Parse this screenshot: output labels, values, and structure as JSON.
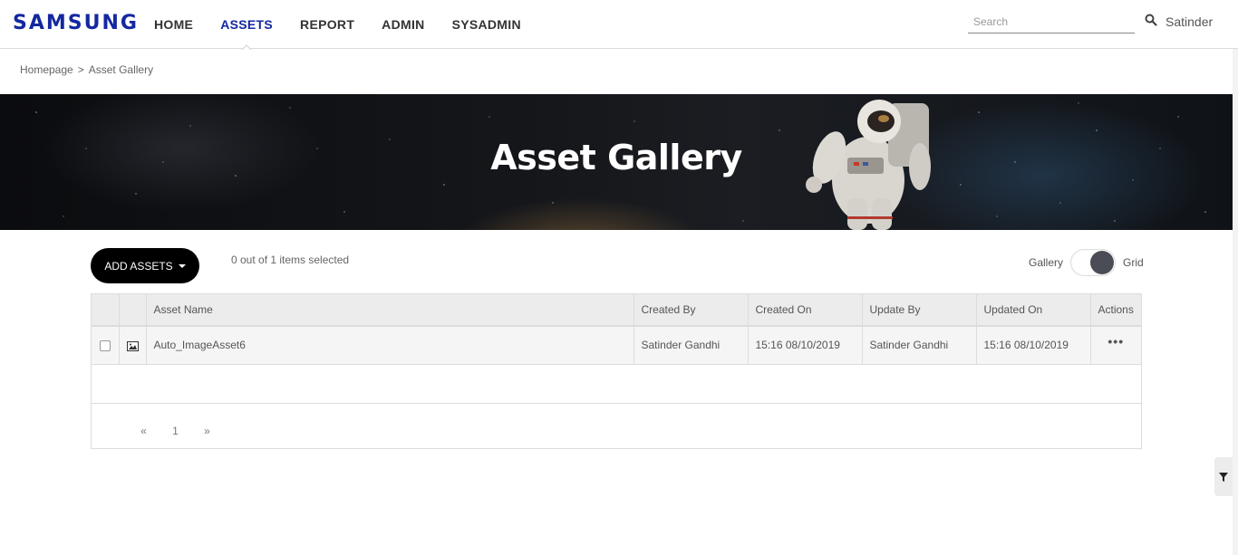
{
  "brand": {
    "logo": "SAMSUNG",
    "logo_color": "#1428a0"
  },
  "nav": {
    "items": [
      {
        "label": "HOME",
        "active": false
      },
      {
        "label": "ASSETS",
        "active": true
      },
      {
        "label": "REPORT",
        "active": false
      },
      {
        "label": "ADMIN",
        "active": false
      },
      {
        "label": "SYSADMIN",
        "active": false
      }
    ]
  },
  "search": {
    "placeholder": "Search",
    "value": "",
    "icon": "search-icon"
  },
  "user": {
    "name": "Satinder"
  },
  "breadcrumb": {
    "home": "Homepage",
    "separator": ">",
    "current": "Asset Gallery"
  },
  "banner": {
    "title": "Asset Gallery"
  },
  "toolbar": {
    "add_assets_label": "ADD ASSETS",
    "selected_text": "0 out of 1 items selected",
    "view_toggle": {
      "left_label": "Gallery",
      "right_label": "Grid",
      "selected": "Grid"
    }
  },
  "table": {
    "columns": [
      "Asset Name",
      "Created By",
      "Created On",
      "Update By",
      "Updated On",
      "Actions"
    ],
    "rows": [
      {
        "checked": false,
        "type_icon": "image-icon",
        "asset_name": "Auto_ImageAsset6",
        "created_by": "Satinder Gandhi",
        "created_on": "15:16 08/10/2019",
        "update_by": "Satinder Gandhi",
        "updated_on": "15:16 08/10/2019",
        "actions": "•••"
      }
    ]
  },
  "pagination": {
    "prev": "«",
    "page": "1",
    "next": "»"
  },
  "filter": {
    "icon": "filter-icon"
  }
}
